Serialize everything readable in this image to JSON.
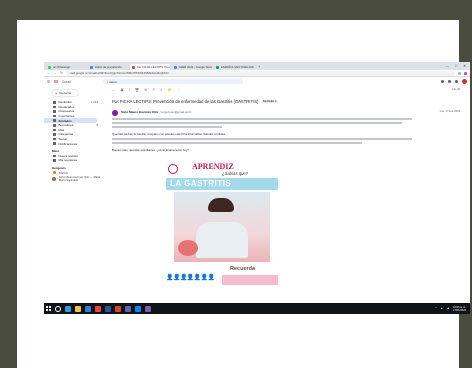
{
  "browser": {
    "tabs": [
      {
        "label": "(2) WhatsApp",
        "color": "#25d366",
        "active": false
      },
      {
        "label": "Diario de preparación",
        "color": "#4285f4",
        "active": false
      },
      {
        "label": "Fw: FICHA LECTIPS: Preven",
        "color": "#ea4335",
        "active": true
      },
      {
        "label": "LEER 2023 - Google Docs",
        "color": "#4285f4",
        "active": false
      },
      {
        "label": "ESPAÑOL/LECTURA 2023 - EJ",
        "color": "#0f9d58",
        "active": false
      }
    ],
    "window_controls": [
      "—",
      "□",
      "✕"
    ],
    "url": "mail.google.com/mail/u/0/#inbox/QgrcJHrnscJDMxXPbKNFXMWkbsGZtrQNCD"
  },
  "gmail": {
    "logo": "M",
    "brand": "Gmail",
    "search_value": "saluid",
    "sidebar": {
      "compose_label": "Redactar",
      "items": [
        {
          "label": "Recibidos",
          "count": "1.244",
          "active": false
        },
        {
          "label": "Destacados",
          "count": "",
          "active": false
        },
        {
          "label": "Pospuestos",
          "count": "",
          "active": false
        },
        {
          "label": "Importantes",
          "count": "",
          "active": false
        },
        {
          "label": "Enviados",
          "count": "",
          "active": true
        },
        {
          "label": "Borradores",
          "count": "5",
          "active": false
        },
        {
          "label": "Más",
          "count": "",
          "active": false
        },
        {
          "label": "Categorías",
          "count": "",
          "active": false
        },
        {
          "label": "Social",
          "count": "",
          "active": false
        },
        {
          "label": "Notificaciones",
          "count": "",
          "active": false
        }
      ],
      "meet_section": "Meet",
      "meet_items": [
        "Nueva reunión",
        "Mis reuniones"
      ],
      "chat_section": "Hangouts",
      "chat_label": "Karina",
      "chat_user": "Sixto Mauro Guzmán Ortiz — Maria María Sajomade"
    },
    "toolbar": {
      "icons": [
        "←",
        "▣",
        "!",
        "🗑",
        "✉",
        "⏱",
        "✓",
        "📁",
        "⋮"
      ],
      "pager": "1 de 39"
    },
    "email": {
      "subject": "Fw: FICHA LECTIPS: Prevención de enfermedad de las Gastritis (GASTRITIS)",
      "folder_chip": "Recibidos ×",
      "sender_name": "Sixto Mauro Guzmán Ortiz",
      "sender_addr": "<smguzman@gmail.com>",
      "date": "mar, 17 ene 2023",
      "body_intro": "Queridos padres de familia, comparto con ustedes esta ficha informativa. Saludos cordiales.",
      "greeting": "Buenos días, queridos estudiantes, ¿cómo amanecieron hoy?"
    },
    "poster": {
      "title": "APRENDIZ",
      "subtitle": "¿Sabías que?",
      "banner": "LA GASTRITIS",
      "recuerda": "Recuerda"
    }
  },
  "taskbar": {
    "icons": [
      {
        "name": "edge-icon",
        "color": "#2b9de0"
      },
      {
        "name": "file-explorer-icon",
        "color": "#f2c14e"
      },
      {
        "name": "store-icon",
        "color": "#3a7bd5"
      },
      {
        "name": "chrome-icon",
        "color": "#e8453c"
      },
      {
        "name": "word-icon",
        "color": "#2b579a"
      },
      {
        "name": "powerpoint-icon",
        "color": "#d24726"
      },
      {
        "name": "teams-icon",
        "color": "#6264a7"
      },
      {
        "name": "photos-icon",
        "color": "#0a84ff"
      },
      {
        "name": "app-icon",
        "color": "#7b5ea7"
      }
    ],
    "time": "10:05 a. m.",
    "date": "17/01/2023"
  }
}
